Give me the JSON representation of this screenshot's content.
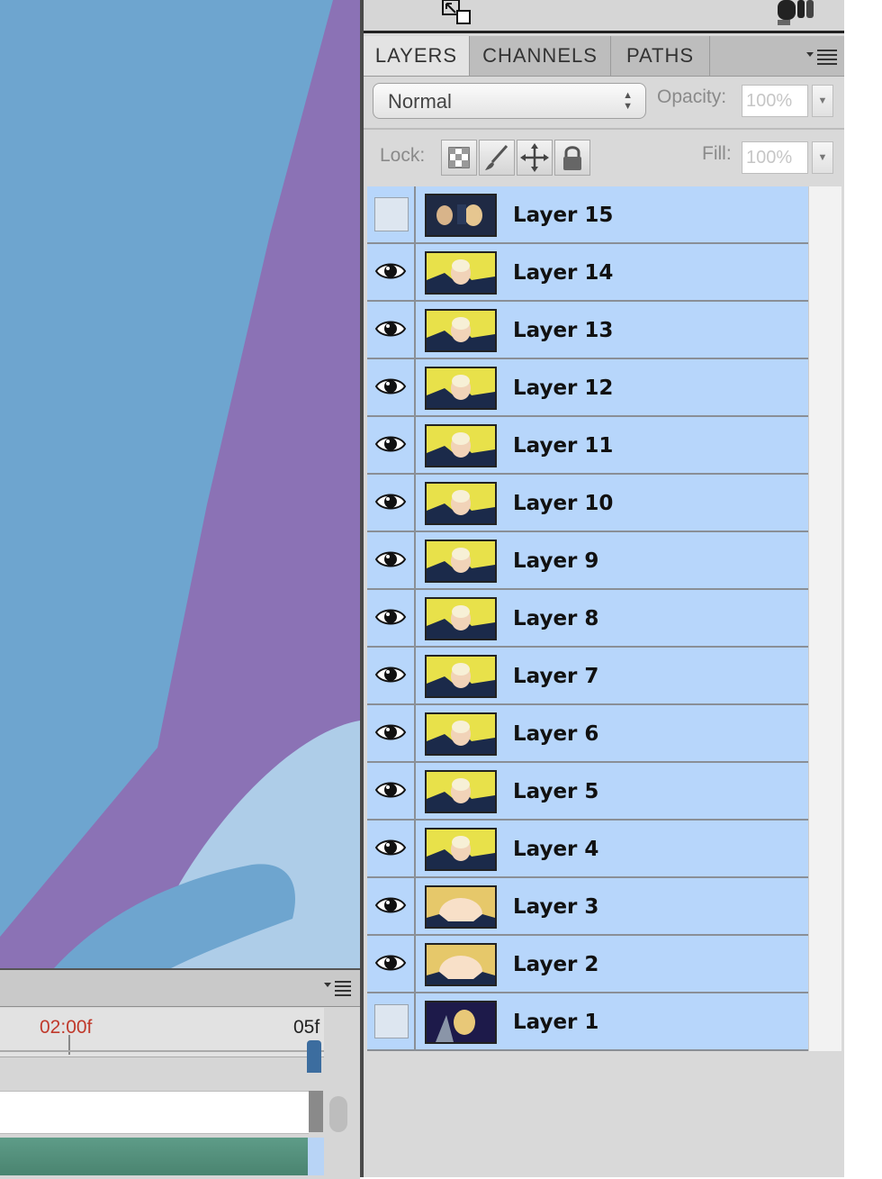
{
  "panel": {
    "tabs": [
      {
        "label": "LAYERS",
        "active": true
      },
      {
        "label": "CHANNELS",
        "active": false
      },
      {
        "label": "PATHS",
        "active": false
      }
    ],
    "blend_mode": "Normal",
    "opacity_label": "Opacity:",
    "opacity_value": "100%",
    "lock_label": "Lock:",
    "fill_label": "Fill:",
    "fill_value": "100%",
    "lock_icons": [
      "transparency-lock-icon",
      "brush-lock-icon",
      "move-lock-icon",
      "padlock-icon"
    ]
  },
  "layers": [
    {
      "name": "Layer 15",
      "visible": false,
      "thumb": "dark"
    },
    {
      "name": "Layer 14",
      "visible": true,
      "thumb": "yellow"
    },
    {
      "name": "Layer 13",
      "visible": true,
      "thumb": "yellow"
    },
    {
      "name": "Layer 12",
      "visible": true,
      "thumb": "yellow"
    },
    {
      "name": "Layer 11",
      "visible": true,
      "thumb": "yellow"
    },
    {
      "name": "Layer 10",
      "visible": true,
      "thumb": "yellow"
    },
    {
      "name": "Layer 9",
      "visible": true,
      "thumb": "yellow"
    },
    {
      "name": "Layer 8",
      "visible": true,
      "thumb": "yellow"
    },
    {
      "name": "Layer 7",
      "visible": true,
      "thumb": "yellow"
    },
    {
      "name": "Layer 6",
      "visible": true,
      "thumb": "yellow"
    },
    {
      "name": "Layer 5",
      "visible": true,
      "thumb": "yellow"
    },
    {
      "name": "Layer 4",
      "visible": true,
      "thumb": "yellow"
    },
    {
      "name": "Layer 3",
      "visible": true,
      "thumb": "glow"
    },
    {
      "name": "Layer 2",
      "visible": true,
      "thumb": "glow"
    },
    {
      "name": "Layer 1",
      "visible": false,
      "thumb": "night"
    }
  ],
  "timeline": {
    "time_marker": "02:00f",
    "time_end": "05f",
    "marker_color": "#c0392b"
  },
  "colors": {
    "canvas_blue": "#6ea5cf",
    "canvas_purple": "#8b72b5",
    "canvas_light": "#aecde8",
    "layer_row": "#b7d6fb"
  }
}
